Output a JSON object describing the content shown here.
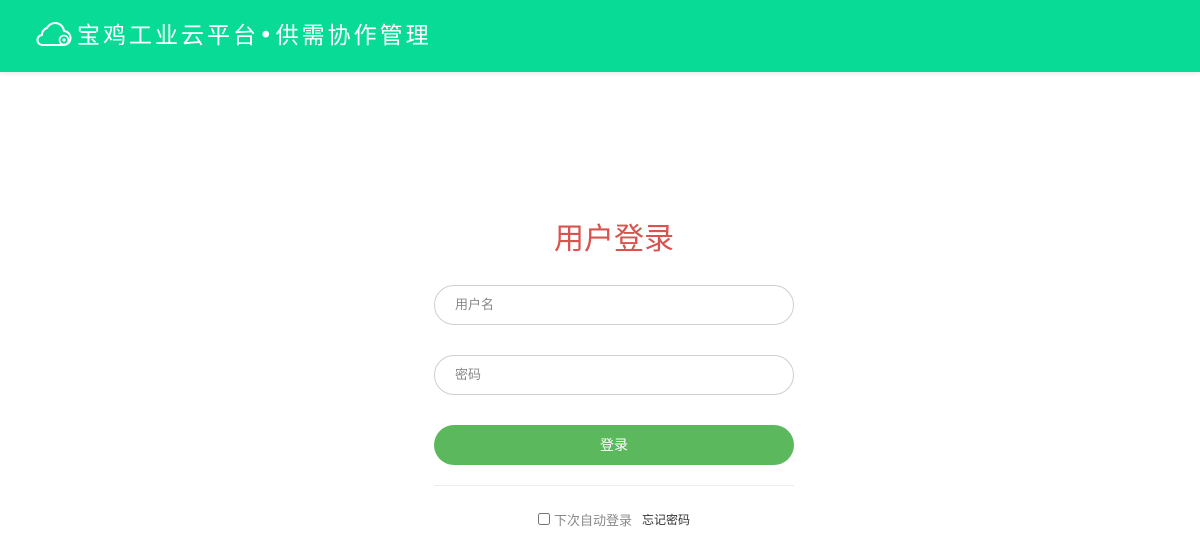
{
  "header": {
    "title": "宝鸡工业云平台•供需协作管理",
    "logo_icon": "cloud-logo-icon",
    "background_color": "#08db95"
  },
  "login": {
    "title": "用户登录",
    "title_color": "#d9534f",
    "username_placeholder": "用户名",
    "password_placeholder": "密码",
    "submit_label": "登录",
    "submit_color": "#5cb85c",
    "remember_label": "下次自动登录",
    "forgot_label": "忘记密码"
  }
}
